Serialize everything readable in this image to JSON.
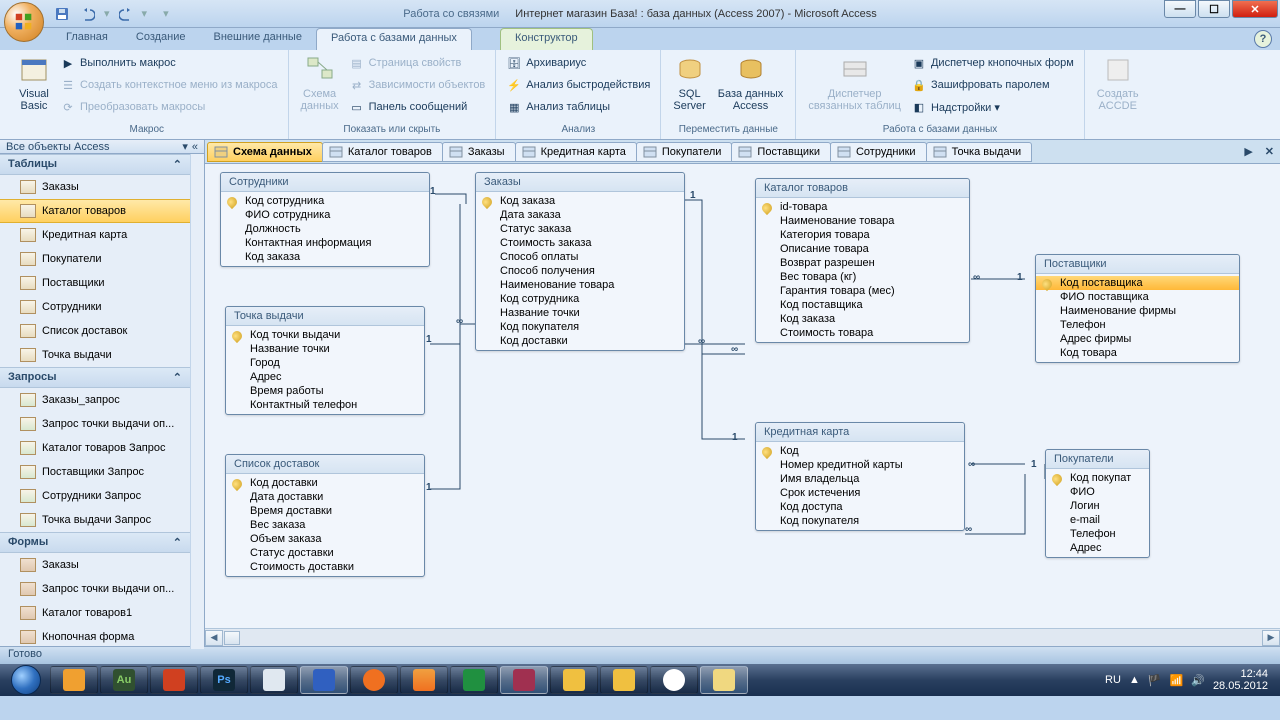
{
  "title": {
    "context_tab": "Работа со связями",
    "main": "Интернет магазин База! : база данных (Access 2007) - Microsoft Access"
  },
  "ribbon_tabs": [
    "Главная",
    "Создание",
    "Внешние данные",
    "Работа с базами данных",
    "Конструктор"
  ],
  "ribbon_active_idx": 3,
  "ribbon": {
    "g0": {
      "vb": "Visual\nBasic",
      "a": "Выполнить макрос",
      "b": "Создать контекстное меню из макроса",
      "c": "Преобразовать макросы",
      "label": "Макрос"
    },
    "g1": {
      "schema": "Схема\nданных",
      "a": "Страница свойств",
      "b": "Зависимости объектов",
      "c": "Панель сообщений",
      "label": "Показать или скрыть"
    },
    "g2": {
      "a": "Архивариус",
      "b": "Анализ быстродействия",
      "c": "Анализ таблицы",
      "label": "Анализ"
    },
    "g3": {
      "sql": "SQL\nServer",
      "acc": "База данных\nAccess",
      "label": "Переместить данные"
    },
    "g4": {
      "disp": "Диспетчер\nсвязанных таблиц",
      "a": "Диспетчер кнопочных форм",
      "b": "Зашифровать паролем",
      "c": "Надстройки ▾",
      "label": "Работа с базами данных"
    },
    "g5": {
      "accde": "Создать\nACCDE"
    }
  },
  "obj_tabs": [
    "Схема данных",
    "Каталог товаров",
    "Заказы",
    "Кредитная карта",
    "Покупатели",
    "Поставщики",
    "Сотрудники",
    "Точка выдачи"
  ],
  "nav": {
    "title": "Все объекты Access",
    "tables_h": "Таблицы",
    "queries_h": "Запросы",
    "forms_h": "Формы",
    "tables": [
      "Заказы",
      "Каталог товаров",
      "Кредитная карта",
      "Покупатели",
      "Поставщики",
      "Сотрудники",
      "Список доставок",
      "Точка выдачи"
    ],
    "tables_sel": 1,
    "queries": [
      "Заказы_запрос",
      "Запрос точки выдачи оп...",
      "Каталог товаров Запрос",
      "Поставщики Запрос",
      "Сотрудники Запрос",
      "Точка выдачи Запрос"
    ],
    "forms": [
      "Заказы",
      "Запрос точки выдачи оп...",
      "Каталог товаров1",
      "Кнопочная форма"
    ]
  },
  "tables": {
    "employees": {
      "title": "Сотрудники",
      "fields": [
        "Код сотрудника",
        "ФИО сотрудника",
        "Должность",
        "Контактная информация",
        "Код заказа"
      ],
      "pk": [
        0
      ]
    },
    "pickup": {
      "title": "Точка выдачи",
      "fields": [
        "Код точки выдачи",
        "Название точки",
        "Город",
        "Адрес",
        "Время работы",
        "Контактный телефон"
      ],
      "pk": [
        0
      ]
    },
    "delivery": {
      "title": "Список доставок",
      "fields": [
        "Код доставки",
        "Дата доставки",
        "Время доставки",
        "Вес заказа",
        "Объем заказа",
        "Статус доставки",
        "Стоимость доставки"
      ],
      "pk": [
        0
      ]
    },
    "orders": {
      "title": "Заказы",
      "fields": [
        "Код заказа",
        "Дата заказа",
        "Статус заказа",
        "Стоимость заказа",
        "Способ оплаты",
        "Способ получения",
        "Наименование товара",
        "Код сотрудника",
        "Название точки",
        "Код покупателя",
        "Код доставки"
      ],
      "pk": [
        0
      ]
    },
    "catalog": {
      "title": "Каталог товаров",
      "fields": [
        "id-товара",
        "Наименование товара",
        "Категория товара",
        "Описание товара",
        "Возврат разрешен",
        "Вес товара (кг)",
        "Гарантия товара (мес)",
        "Код поставщика",
        "Код заказа",
        "Стоимость товара"
      ],
      "pk": [
        0
      ]
    },
    "card": {
      "title": "Кредитная карта",
      "fields": [
        "Код",
        "Номер кредитной карты",
        "Имя владельца",
        "Срок истечения",
        "Код доступа",
        "Код покупателя"
      ],
      "pk": [
        0
      ]
    },
    "suppliers": {
      "title": "Поставщики",
      "fields": [
        "Код поставщика",
        "ФИО поставщика",
        "Наименование фирмы",
        "Телефон",
        "Адрес фирмы",
        "Код товара"
      ],
      "pk": [
        0
      ],
      "sel": 0
    },
    "buyers": {
      "title": "Покупатели",
      "fields": [
        "Код покупат",
        "ФИО",
        "Логин",
        "e-mail",
        "Телефон",
        "Адрес"
      ],
      "pk": [
        0
      ]
    }
  },
  "status": "Готово",
  "tray": {
    "lang": "RU",
    "time": "12:44",
    "date": "28.05.2012"
  }
}
